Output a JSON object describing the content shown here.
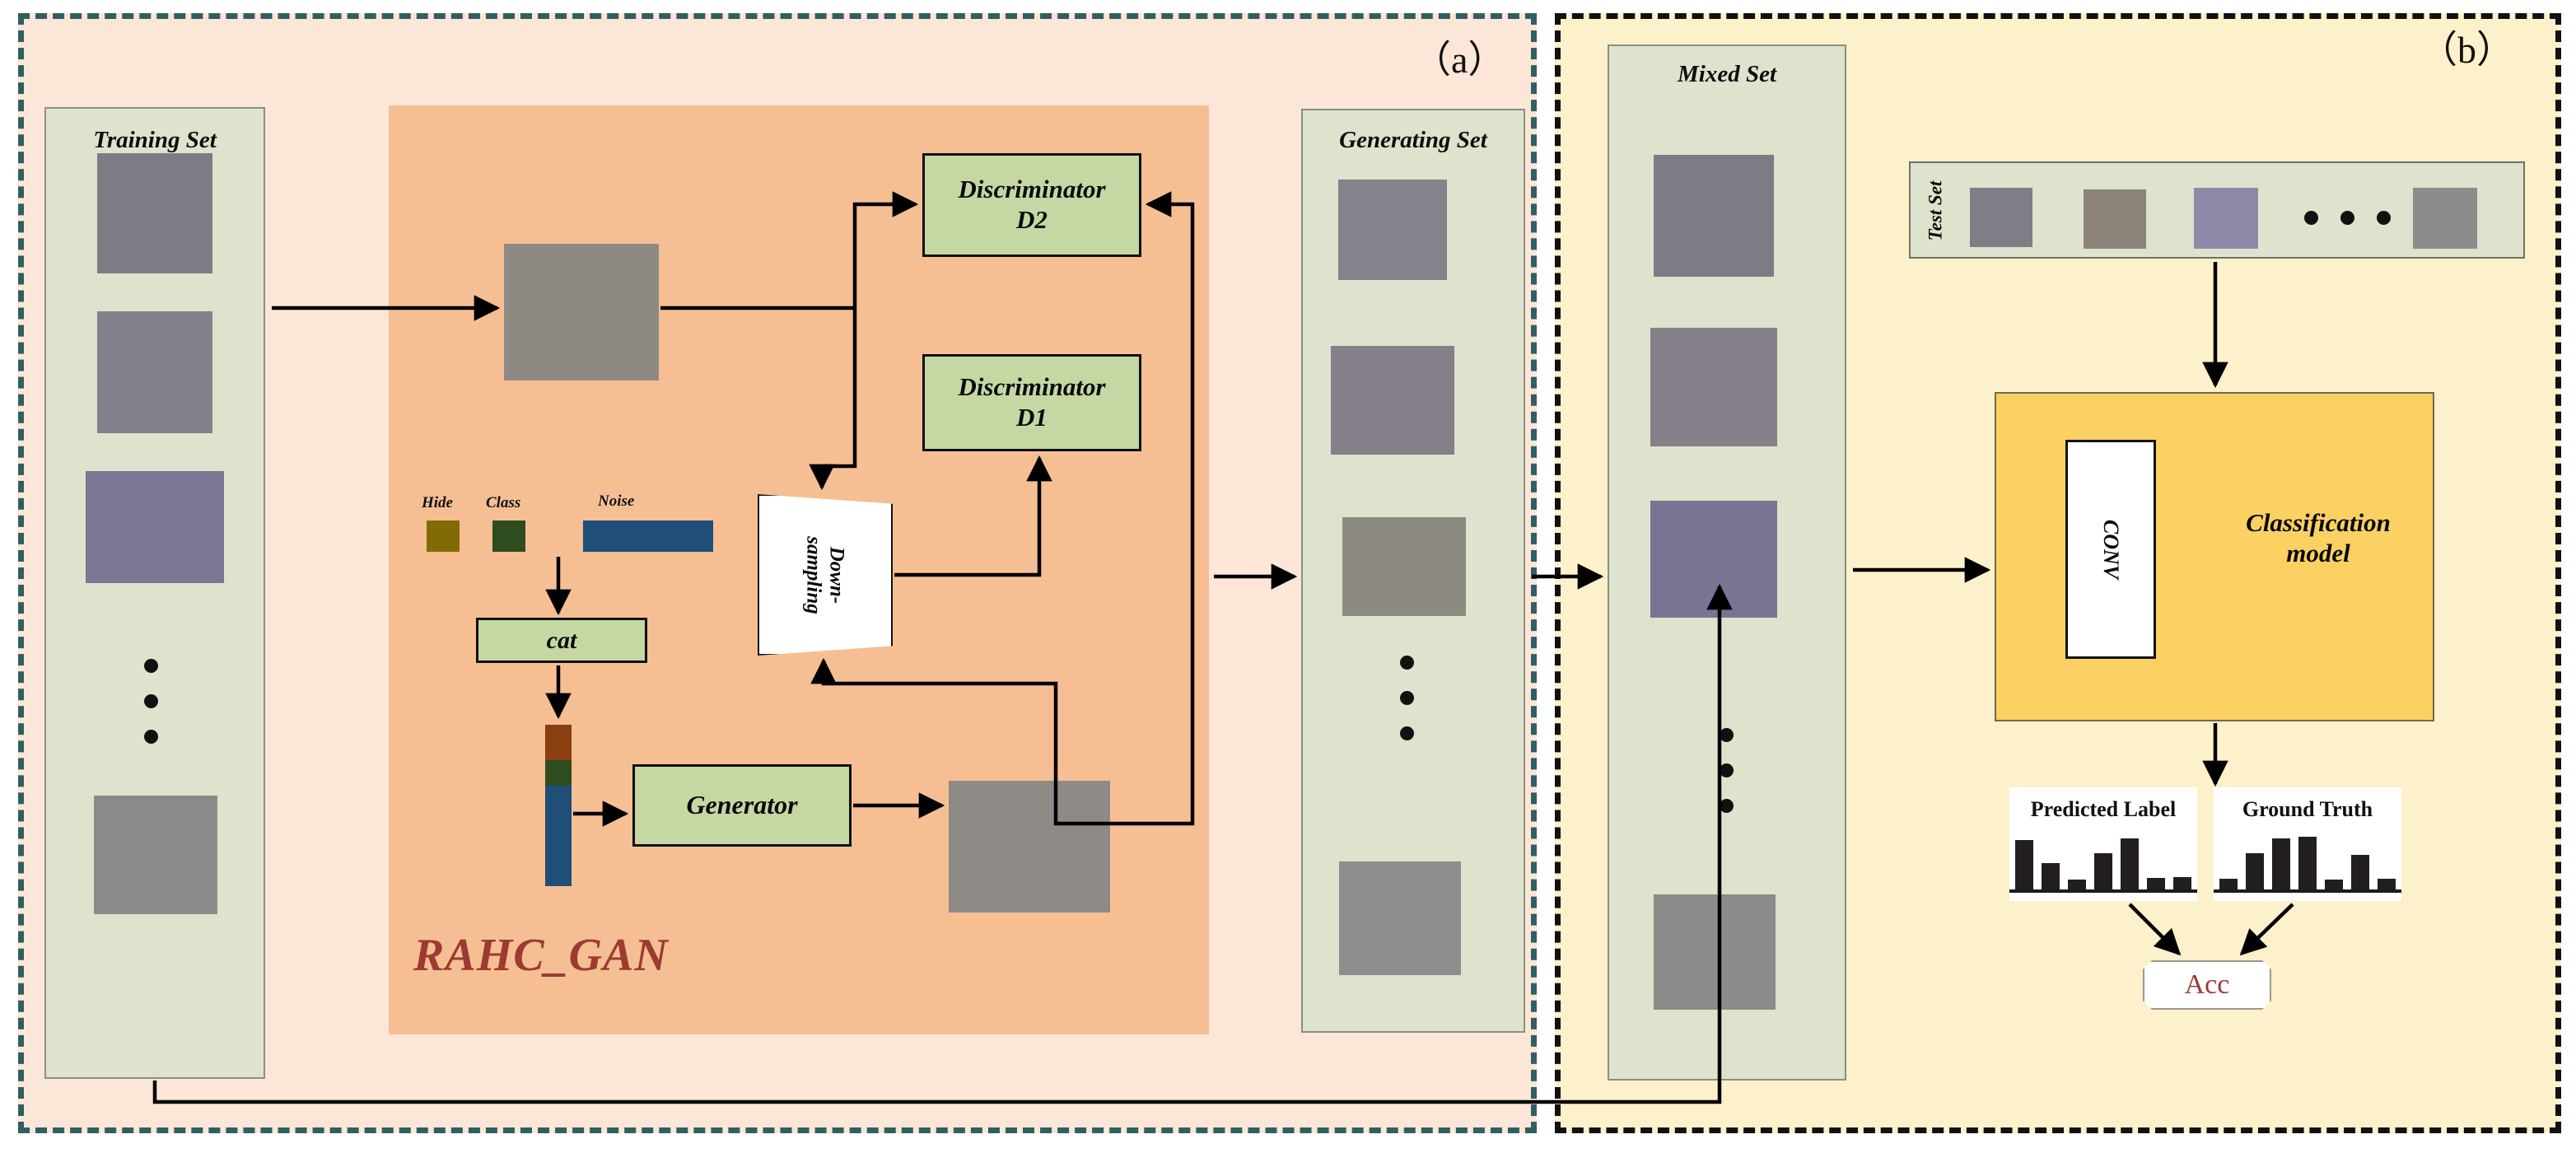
{
  "figure": {
    "panels": [
      {
        "id": "a",
        "tag": "（a）",
        "border_color": "#2f5f63",
        "background": "#fbe6d8"
      },
      {
        "id": "b",
        "tag": "（b）",
        "border_color": "#111111",
        "background": "#fdf1cb"
      }
    ]
  },
  "panel_a": {
    "training_set": {
      "title": "Training Set",
      "ellipsis": "vertical-dots",
      "images": [
        {
          "name": "healthy-green-leaf",
          "leaf": "#7fa84e",
          "accent": "#4c7a2a",
          "bg": "#7f7b86"
        },
        {
          "name": "late-blight-leaf",
          "leaf": "#62883f",
          "accent": "#3c5a26",
          "bg": "#84808c"
        },
        {
          "name": "yellow-spotted-leaf",
          "leaf": "#c9c455",
          "accent": "#8a6b22",
          "bg": "#7c7594"
        },
        {
          "name": "mosaic-virus-leaf",
          "leaf": "#cfe05a",
          "accent": "#4f8a25",
          "bg": "#8b8b8b"
        }
      ]
    },
    "gan": {
      "title": "RAHC_GAN",
      "title_color": "#9c3a33",
      "background": "#f6bf93",
      "input_image": {
        "name": "diseased-input-leaf",
        "leaf": "#39622f",
        "accent": "#b9c33a",
        "bg": "#8d8a84"
      },
      "output_image": {
        "name": "generated-leaf",
        "leaf": "#3f6b33",
        "accent": "#c0b841",
        "bg": "#8e8b87"
      },
      "discriminator_d2": "Discriminator\nD2",
      "discriminator_d2_l1": "Discriminator",
      "discriminator_d2_l2": "D2",
      "discriminator_d1_l1": "Discriminator",
      "discriminator_d1_l2": "D1",
      "downsampling": "Down-\nsampling",
      "downsampling_l1": "Down-",
      "downsampling_l2": "sampling",
      "cat": "cat",
      "generator": "Generator",
      "legend": [
        {
          "label": "Hide",
          "color": "#826a06"
        },
        {
          "label": "Class",
          "color": "#2e4c20"
        },
        {
          "label": "Noise",
          "color": "#1f4e79"
        }
      ],
      "concat_bar": [
        {
          "name": "hide-segment",
          "color": "#8a3f10",
          "fraction": 0.22
        },
        {
          "name": "class-segment",
          "color": "#2e4c20",
          "fraction": 0.16
        },
        {
          "name": "noise-segment",
          "color": "#1f4e79",
          "fraction": 0.62
        }
      ]
    },
    "generating_set": {
      "title": "Generating Set",
      "ellipsis": "vertical-dots",
      "images": [
        {
          "name": "generated-healthy-leaf",
          "leaf": "#8fae6b",
          "accent": "#6d8f4c",
          "bg": "#85828b"
        },
        {
          "name": "generated-blight-leaf",
          "leaf": "#547c35",
          "accent": "#8d7a2a",
          "bg": "#847f89"
        },
        {
          "name": "generated-spotted-leaf",
          "leaf": "#9aa83c",
          "accent": "#7b4f1c",
          "bg": "#8d8a82"
        },
        {
          "name": "generated-mosaic-leaf",
          "leaf": "#cfe05a",
          "accent": "#56912a",
          "bg": "#8d8d8d"
        }
      ]
    }
  },
  "panel_b": {
    "mixed_set": {
      "title": "Mixed Set",
      "ellipsis": "vertical-dots",
      "images": [
        {
          "name": "mixed-healthy-leaf",
          "leaf": "#7fa84e",
          "accent": "#4c7a2a",
          "bg": "#7f7b86"
        },
        {
          "name": "mixed-blight-leaf",
          "leaf": "#5d8136",
          "accent": "#8f7b2c",
          "bg": "#858089"
        },
        {
          "name": "mixed-yellow-leaf",
          "leaf": "#c3c24f",
          "accent": "#7f5f1e",
          "bg": "#7a7392"
        },
        {
          "name": "mixed-mosaic-leaf",
          "leaf": "#cfe05a",
          "accent": "#4f8a25",
          "bg": "#8b8b8b"
        }
      ]
    },
    "test_set": {
      "title": "Test Set",
      "ellipsis": "horizontal-dots",
      "images": [
        {
          "name": "test-healthy-leaf",
          "leaf": "#8aa66a",
          "accent": "#6d8a4e",
          "bg": "#7f7d85"
        },
        {
          "name": "test-blight-leaf",
          "leaf": "#5d8136",
          "accent": "#8b7a2e",
          "bg": "#8b8279"
        },
        {
          "name": "test-spotted-leaf",
          "leaf": "#5d8a39",
          "accent": "#b3b63b",
          "bg": "#8d8aa8"
        },
        {
          "name": "test-mosaic-leaf",
          "leaf": "#c6dd5c",
          "accent": "#5d9a2c",
          "bg": "#8c8c8c"
        }
      ]
    },
    "classifier": {
      "conv": "CONV",
      "title_l1": "Classification",
      "title_l2": "model",
      "background": "#fbd163"
    },
    "evaluation": {
      "predicted_label": {
        "title": "Predicted Label",
        "bars": [
          60,
          32,
          12,
          44,
          62,
          14,
          15
        ]
      },
      "ground_truth": {
        "title": "Ground Truth",
        "bars": [
          13,
          44,
          62,
          64,
          12,
          42,
          13
        ]
      },
      "acc": "Acc",
      "acc_color": "#9c3a33"
    }
  }
}
